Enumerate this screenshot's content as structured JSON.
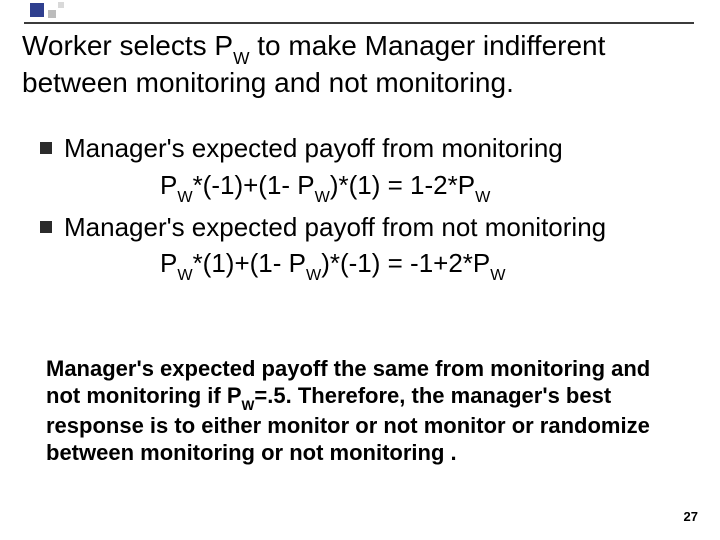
{
  "title": {
    "pre": "Worker selects P",
    "sub": "W",
    "post": " to make Manager indifferent between monitoring and not monitoring."
  },
  "bullets": [
    {
      "text": "Manager's expected payoff from monitoring",
      "formula": {
        "p1_pre": "P",
        "p1_sub": "W",
        "p1_post": "*(-1)+(1- P",
        "p2_sub": "W",
        "p2_post": ")*(1) = 1-2*P",
        "p3_sub": "W"
      }
    },
    {
      "text": "Manager's expected payoff from not monitoring",
      "formula": {
        "p1_pre": "P",
        "p1_sub": "W",
        "p1_post": "*(1)+(1- P",
        "p2_sub": "W",
        "p2_post": ")*(-1) = -1+2*P",
        "p3_sub": "W"
      }
    }
  ],
  "conclusion": {
    "s1": "Manager's expected payoff the same from monitoring and not monitoring if P",
    "s1_sub": "W",
    "s2": "=.5. Therefore, the manager's best response is to either monitor or not monitor or randomize between monitoring or not monitoring ."
  },
  "page_number": "27"
}
